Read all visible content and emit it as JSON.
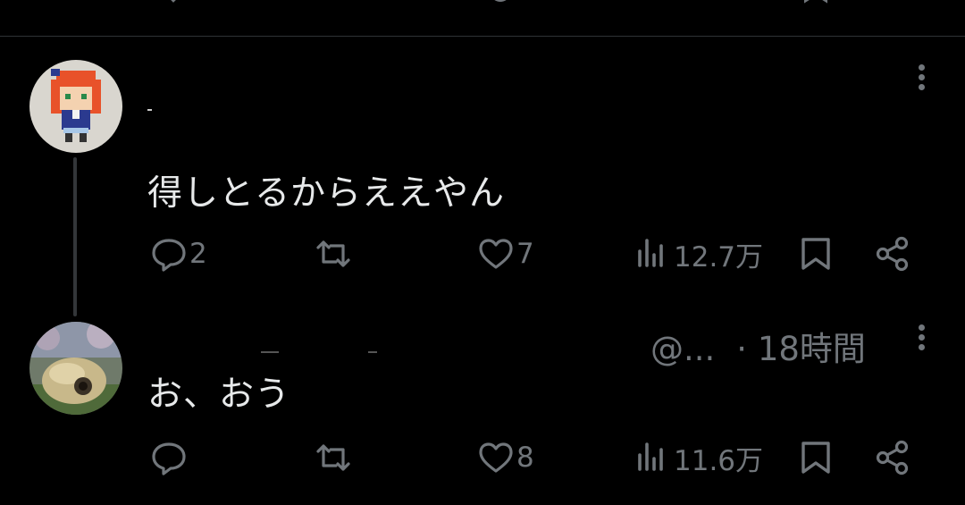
{
  "posts": [
    {
      "text": "得しとるからええやん",
      "stats": {
        "replies": "2",
        "reposts": "",
        "likes": "7",
        "views": "12.7万"
      },
      "icons": {
        "reply": "reply-icon",
        "repost": "repost-icon",
        "like": "heart-icon",
        "views": "views-icon",
        "bookmark": "bookmark-icon",
        "share": "share-icon",
        "more": "more-icon"
      }
    },
    {
      "handle": "@...",
      "time": "· 18時間",
      "text": "お、おう",
      "stats": {
        "replies": "",
        "reposts": "",
        "likes": "8",
        "views": "11.6万"
      }
    }
  ],
  "colors": {
    "background": "#000000",
    "text": "#e7e9ea",
    "muted": "#71767b",
    "divider": "#2f3336"
  }
}
